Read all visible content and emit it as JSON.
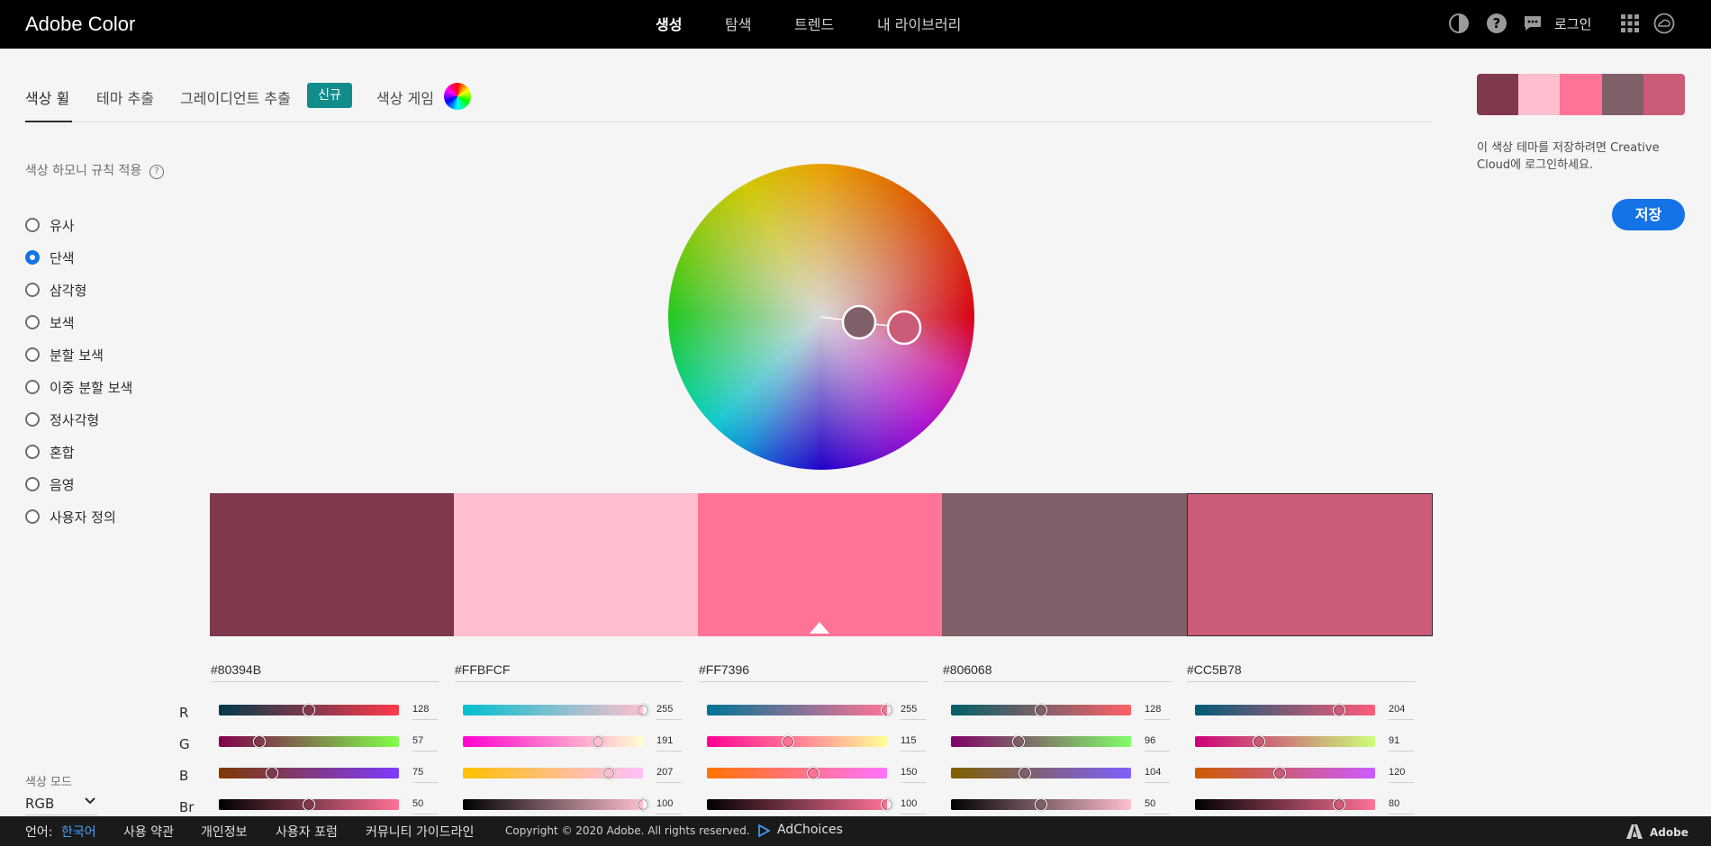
{
  "app": {
    "title": "Adobe Color"
  },
  "topnav": {
    "items": [
      "생성",
      "탐색",
      "트렌드",
      "내 라이브러리"
    ],
    "active": "생성"
  },
  "topright": {
    "login": "로그인",
    "icons": [
      "contrast-icon",
      "help-icon",
      "chat-icon",
      "apps-grid-icon",
      "creative-cloud-icon"
    ]
  },
  "tabs": {
    "items": [
      "색상 휠",
      "테마 추출",
      "그레이디언트 추출",
      "색상 게임"
    ],
    "new_badge": "신규",
    "active": "색상 휠"
  },
  "harmony": {
    "title": "색상 하모니 규칙 적용",
    "help": "?",
    "rules": [
      "유사",
      "단색",
      "삼각형",
      "보색",
      "분할 보색",
      "이중 분할 보색",
      "정사각형",
      "혼합",
      "음영",
      "사용자 정의"
    ],
    "selected_index": 1
  },
  "color_mode": {
    "label": "색상 모드",
    "value": "RGB"
  },
  "colors": {
    "list": [
      {
        "hex": "#80394B",
        "r": "128",
        "g": "57",
        "b": "75",
        "br": "50"
      },
      {
        "hex": "#FFBFCF",
        "r": "255",
        "g": "191",
        "b": "207",
        "br": "100"
      },
      {
        "hex": "#FF7396",
        "r": "255",
        "g": "115",
        "b": "150",
        "br": "100"
      },
      {
        "hex": "#806068",
        "r": "128",
        "g": "96",
        "b": "104",
        "br": "50"
      },
      {
        "hex": "#CC5B78",
        "r": "204",
        "g": "91",
        "b": "120",
        "br": "80"
      }
    ],
    "base_index": 2,
    "selected_index": 4,
    "channel_labels": [
      "R",
      "G",
      "B",
      "Br"
    ]
  },
  "save_panel": {
    "hint": "이 색상 테마를 저장하려면 Creative Cloud에 로그인하세요.",
    "button": "저장"
  },
  "footer": {
    "language_label": "언어:",
    "language_value": "한국어",
    "links": [
      "사용 약관",
      "개인정보",
      "사용자 포럼",
      "커뮤니티 가이드라인"
    ],
    "copyright": "Copyright © 2020 Adobe. All rights reserved.",
    "adchoices": "AdChoices",
    "adobe": "Adobe"
  },
  "accent_colors": {
    "primary": "#1473e6",
    "badge": "#138c8c"
  }
}
